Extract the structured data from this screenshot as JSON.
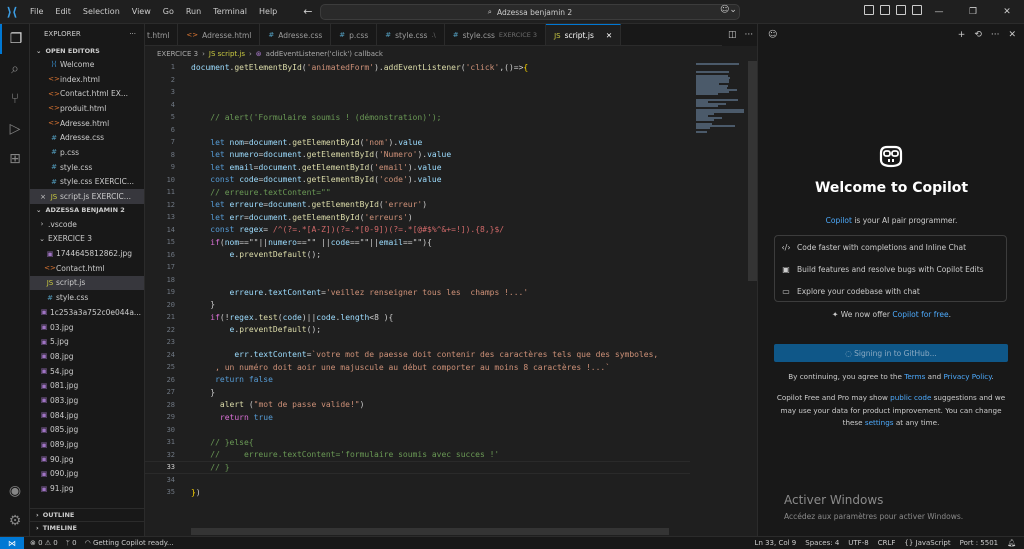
{
  "titlebar": {
    "menu": [
      "File",
      "Edit",
      "Selection",
      "View",
      "Go",
      "Run",
      "Terminal",
      "Help"
    ],
    "search_text": "Adzessa benjamin 2"
  },
  "sidebar": {
    "title": "EXPLORER",
    "more": "···",
    "open_editors_title": "OPEN EDITORS",
    "open_editors": [
      {
        "label": "Welcome",
        "icon": "vscode-icon",
        "type": "vsc",
        "mark": ""
      },
      {
        "label": "index.html",
        "icon": "html-icon",
        "type": "html",
        "mark": ""
      },
      {
        "label": "Contact.html EX...",
        "icon": "html-icon",
        "type": "html",
        "mark": ""
      },
      {
        "label": "produit.html",
        "icon": "html-icon",
        "type": "html",
        "mark": ""
      },
      {
        "label": "Adresse.html",
        "icon": "html-icon",
        "type": "html",
        "mark": ""
      },
      {
        "label": "Adresse.css",
        "icon": "css-icon",
        "type": "css",
        "mark": ""
      },
      {
        "label": "p.css",
        "icon": "css-icon",
        "type": "css",
        "mark": ""
      },
      {
        "label": "style.css",
        "icon": "css-icon",
        "type": "css",
        "mark": ""
      },
      {
        "label": "style.css EXERCIC...",
        "icon": "css-icon",
        "type": "css",
        "mark": ""
      },
      {
        "label": "script.js EXERCIC...",
        "icon": "js-icon",
        "type": "js",
        "mark": "×"
      }
    ],
    "folder_title": "ADZESSA BENJAMIN 2",
    "folder": [
      {
        "label": ".vscode",
        "kind": "folder",
        "arrow": "›"
      },
      {
        "label": "EXERCICE 3",
        "kind": "folder",
        "arrow": "⌄"
      },
      {
        "label": "1744645812862.jpg",
        "kind": "img"
      },
      {
        "label": "Contact.html",
        "kind": "html"
      },
      {
        "label": "script.js",
        "kind": "js"
      },
      {
        "label": "style.css",
        "kind": "css"
      },
      {
        "label": "1c253a3a752c0e044a...",
        "kind": "img"
      },
      {
        "label": "03.jpg",
        "kind": "img"
      },
      {
        "label": "5.jpg",
        "kind": "img"
      },
      {
        "label": "08.jpg",
        "kind": "img"
      },
      {
        "label": "54.jpg",
        "kind": "img"
      },
      {
        "label": "081.jpg",
        "kind": "img"
      },
      {
        "label": "083.jpg",
        "kind": "img"
      },
      {
        "label": "084.jpg",
        "kind": "img"
      },
      {
        "label": "085.jpg",
        "kind": "img"
      },
      {
        "label": "089.jpg",
        "kind": "img"
      },
      {
        "label": "90.jpg",
        "kind": "img"
      },
      {
        "label": "090.jpg",
        "kind": "img"
      },
      {
        "label": "91.jpg",
        "kind": "img"
      }
    ],
    "outline_title": "OUTLINE",
    "timeline_title": "TIMELINE"
  },
  "tabs": [
    {
      "label": "t.html",
      "icon": "",
      "sub": "",
      "active": false
    },
    {
      "label": "Adresse.html",
      "icon": "<>",
      "sub": "",
      "active": false,
      "type": "html"
    },
    {
      "label": "Adresse.css",
      "icon": "#",
      "sub": "",
      "active": false,
      "type": "css"
    },
    {
      "label": "p.css",
      "icon": "#",
      "sub": "",
      "active": false,
      "type": "css"
    },
    {
      "label": "style.css",
      "icon": "#",
      "sub": ".\\",
      "active": false,
      "type": "css"
    },
    {
      "label": "style.css",
      "icon": "#",
      "sub": "EXERCICE 3",
      "active": false,
      "type": "css"
    },
    {
      "label": "script.js",
      "icon": "JS",
      "sub": "",
      "active": true,
      "type": "js"
    }
  ],
  "breadcrumb": [
    "EXERCICE 3",
    "JS script.js",
    "addEventListener('click') callback"
  ],
  "editor": {
    "current_line": 33,
    "lines": [
      {
        "n": 1,
        "html": "<span class='v'>document</span>.<span class='f'>getElementById</span>(<span class='s'>'animatedForm'</span>).<span class='f'>addEventListener</span>(<span class='s'>'click'</span>,()=&gt;<span class='b'>{</span>"
      },
      {
        "n": 2,
        "html": ""
      },
      {
        "n": 3,
        "html": ""
      },
      {
        "n": 4,
        "html": ""
      },
      {
        "n": 5,
        "html": "    <span class='c'>// alert('Formulaire soumis ! (démonstration)');</span>"
      },
      {
        "n": 6,
        "html": ""
      },
      {
        "n": 7,
        "html": "    <span class='k'>let</span> <span class='v'>nom</span>=<span class='v'>document</span>.<span class='f'>getElementById</span>(<span class='s'>'nom'</span>).<span class='v'>value</span>"
      },
      {
        "n": 8,
        "html": "    <span class='k'>let</span> <span class='v'>numero</span>=<span class='v'>document</span>.<span class='f'>getElementById</span>(<span class='s'>'Numero'</span>).<span class='v'>value</span>"
      },
      {
        "n": 9,
        "html": "    <span class='k'>let</span> <span class='v'>email</span>=<span class='v'>document</span>.<span class='f'>getElementById</span>(<span class='s'>'email'</span>).<span class='v'>value</span>"
      },
      {
        "n": 10,
        "html": "    <span class='k'>const</span> <span class='v'>code</span>=<span class='v'>document</span>.<span class='f'>getElementById</span>(<span class='s'>'code'</span>).<span class='v'>value</span>"
      },
      {
        "n": 11,
        "html": "    <span class='c'>// erreure.textContent=\"\"</span>"
      },
      {
        "n": 12,
        "html": "    <span class='k'>let</span> <span class='v'>erreure</span>=<span class='v'>document</span>.<span class='f'>getElementById</span>(<span class='s'>'erreur'</span>)"
      },
      {
        "n": 13,
        "html": "    <span class='k'>let</span> <span class='v'>err</span>=<span class='v'>document</span>.<span class='f'>getElementById</span>(<span class='s'>'erreurs'</span>)"
      },
      {
        "n": 14,
        "html": "    <span class='k'>const</span> <span class='v'>regex</span>= <span class='r'>/^(?=.*[A-Z])(?=.*[0-9])(?=.*[@#$%^&amp;+=!]).{8,}$/</span>"
      },
      {
        "n": 15,
        "html": "    <span class='p'>if</span>(<span class='v'>nom</span>==\"\"||<span class='v'>numero</span>==\"\" ||<span class='v'>code</span>==\"\"||<span class='v'>email</span>==\"\"){"
      },
      {
        "n": 16,
        "html": "        <span class='v'>e</span>.<span class='f'>preventDefault</span>();"
      },
      {
        "n": 17,
        "html": ""
      },
      {
        "n": 18,
        "html": ""
      },
      {
        "n": 19,
        "html": "        <span class='v'>erreure</span>.<span class='v'>textContent</span>=<span class='s'>'veillez renseigner tous les  champs !...'</span>"
      },
      {
        "n": 20,
        "html": "    }"
      },
      {
        "n": 21,
        "html": "    <span class='p'>if</span>(!<span class='v'>regex</span>.<span class='f'>test</span>(<span class='v'>code</span>)||<span class='v'>code</span>.<span class='v'>length</span>&lt;8 ){"
      },
      {
        "n": 22,
        "html": "        <span class='v'>e</span>.<span class='f'>preventDefault</span>();"
      },
      {
        "n": 23,
        "html": ""
      },
      {
        "n": 24,
        "html": "         <span class='v'>err</span>.<span class='v'>textContent</span>=<span class='s'>`votre mot de paesse doit contenir des caractères tels que des symboles,</span>"
      },
      {
        "n": 25,
        "html": "<span class='s'>     , un numéro doit aoir une majuscule au début comporter au moins 8 caractères !...`</span>"
      },
      {
        "n": 26,
        "html": "     <span class='k'>return</span> <span class='k'>false</span>"
      },
      {
        "n": 27,
        "html": "    }"
      },
      {
        "n": 28,
        "html": "      <span class='f'>alert</span> (<span class='s'>\"mot de passe valide!\"</span>)"
      },
      {
        "n": 29,
        "html": "      <span class='p'>return</span> <span class='k'>true</span>"
      },
      {
        "n": 30,
        "html": ""
      },
      {
        "n": 31,
        "html": "    <span class='c'>// }else{</span>"
      },
      {
        "n": 32,
        "html": "    <span class='c'>//     erreure.textContent='formulaire soumis avec succes !'</span>"
      },
      {
        "n": 33,
        "html": "    <span class='c'>// }</span>"
      },
      {
        "n": 34,
        "html": ""
      },
      {
        "n": 35,
        "html": "<span class='b'>}</span>)"
      }
    ]
  },
  "copilot": {
    "welcome": "Welcome to Copilot",
    "tagline_link": "Copilot",
    "tagline_rest": " is your AI pair programmer.",
    "features": [
      {
        "icon": "code-icon",
        "glyph": "‹/›",
        "label": "Code faster with completions and Inline Chat"
      },
      {
        "icon": "edit-icon",
        "glyph": "▣",
        "label": "Build features and resolve bugs with Copilot Edits"
      },
      {
        "icon": "chat-icon",
        "glyph": "▭",
        "label": "Explore your codebase with chat"
      }
    ],
    "offer_text": "We now offer ",
    "offer_link": "Copilot for free",
    "offer_end": ".",
    "signin_label": "Signing in to GitHub...",
    "terms_prefix": "By continuing, you agree to the ",
    "terms_link": "Terms",
    "terms_and": " and ",
    "privacy_link": "Privacy Policy",
    "terms_end": ".",
    "free_prefix": "Copilot Free and Pro may show ",
    "free_link1": "public code",
    "free_mid": " suggestions and we may use your data for product improvement. You can change these ",
    "free_link2": "settings",
    "free_end": " at any time.",
    "activate_title": "Activer Windows",
    "activate_sub": "Accédez aux paramètres pour activer Windows."
  },
  "statusbar": {
    "problems": "⊗ 0 ⚠ 0",
    "ports": "ᛘ 0",
    "copilot_status": "Getting Copilot ready...",
    "position": "Ln 33, Col 9",
    "spaces": "Spaces: 4",
    "encoding": "UTF-8",
    "eol": "CRLF",
    "language": "{} JavaScript",
    "port": "Port : 5501"
  },
  "colors": {
    "accent": "#0078d4",
    "background": "#1f1f1f",
    "sidebar": "#181818"
  }
}
